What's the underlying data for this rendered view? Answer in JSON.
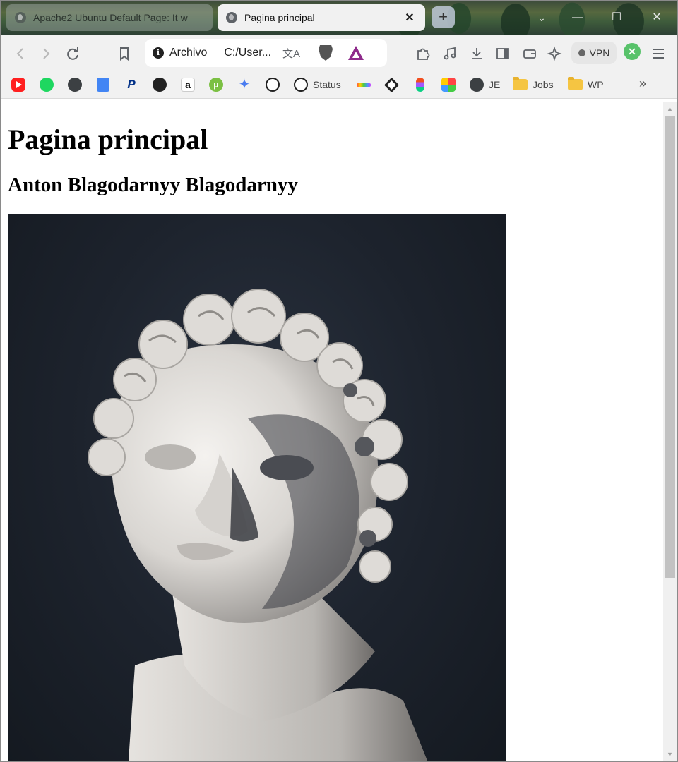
{
  "browser": {
    "tabs": [
      {
        "title": "Apache2 Ubuntu Default Page: It w",
        "active": false
      },
      {
        "title": "Pagina principal",
        "active": true,
        "close": "✕"
      }
    ],
    "new_tab": "+",
    "window_controls": {
      "minimize": "—",
      "maximize": "☐",
      "close": "✕",
      "tab_search": "⌄"
    },
    "toolbar": {
      "back_icon": "chevron-left-icon",
      "forward_icon": "chevron-right-icon",
      "reload_icon": "reload-icon",
      "bookmark_icon": "bookmark-icon",
      "scheme_label": "Archivo",
      "url": "C:/User...",
      "vpn_label": "VPN"
    },
    "bookmarks": [
      {
        "icon": "youtube-icon",
        "label": ""
      },
      {
        "icon": "spotify-icon",
        "label": ""
      },
      {
        "icon": "globe-icon",
        "label": ""
      },
      {
        "icon": "google-docs-icon",
        "label": ""
      },
      {
        "icon": "paypal-icon",
        "label": ""
      },
      {
        "icon": "github-icon",
        "label": ""
      },
      {
        "icon": "amazon-icon",
        "label": ""
      },
      {
        "icon": "utorrent-icon",
        "label": ""
      },
      {
        "icon": "gemini-icon",
        "label": ""
      },
      {
        "icon": "chatgpt-icon",
        "label": ""
      },
      {
        "icon": "chatgpt-icon",
        "label": "Status"
      },
      {
        "icon": "color-bar-icon",
        "label": ""
      },
      {
        "icon": "codepen-icon",
        "label": ""
      },
      {
        "icon": "figma-icon",
        "label": ""
      },
      {
        "icon": "app-icon",
        "label": ""
      },
      {
        "icon": "globe-icon",
        "label": "JE"
      },
      {
        "icon": "folder-icon",
        "label": "Jobs"
      },
      {
        "icon": "folder-icon",
        "label": "WP"
      }
    ],
    "bookmarks_more": "»"
  },
  "page": {
    "heading": "Pagina principal",
    "subheading": "Anton Blagodarnyy Blagodarnyy",
    "image_subject": "statue-bust-image"
  },
  "colors": {
    "photo_background": "#1d232d",
    "statue": "#e9e7e4",
    "tab_active": "#f1f1f1",
    "toolbar": "#f1f1f1"
  }
}
